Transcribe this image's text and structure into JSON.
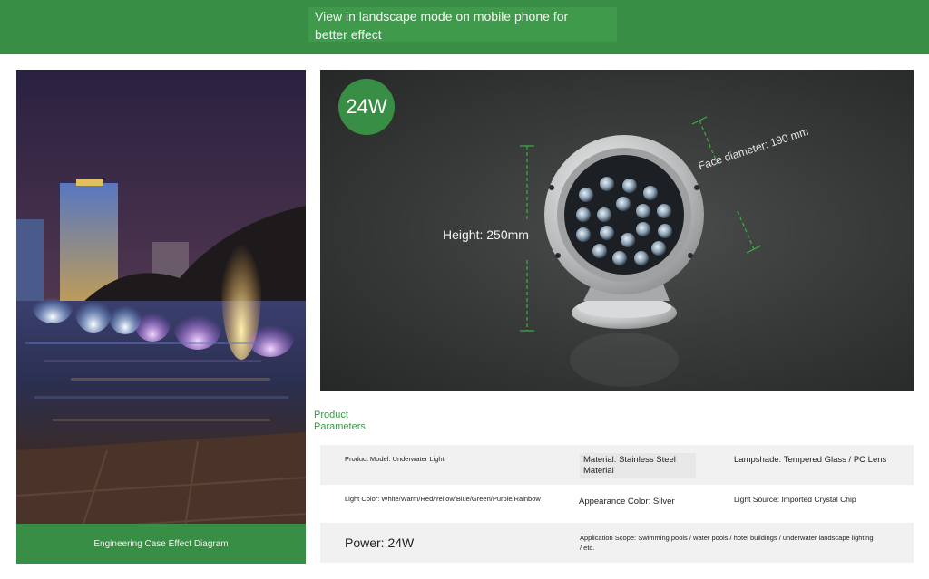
{
  "banner": {
    "notice_line1": "View in landscape mode on mobile phone for",
    "notice_line2": "better effect"
  },
  "case_image": {
    "caption": "Engineering Case Effect Diagram"
  },
  "product_image": {
    "power_badge": "24W",
    "height_label": "Height: 250mm",
    "face_label": "Face diameter: 190 mm"
  },
  "parameters": {
    "title_line1": "Product",
    "title_line2": "Parameters",
    "product_model": "Product Model: Underwater Light",
    "material_line1": "Material: Stainless Steel",
    "material_line2": "Material",
    "lampshade": "Lampshade: Tempered Glass / PC Lens",
    "light_color": "Light Color: White/Warm/Red/Yellow/Blue/Green/Purple/Rainbow",
    "appearance_color": "Appearance Color: Silver",
    "light_source": "Light Source: Imported Crystal Chip",
    "power": "Power: 24W",
    "application_line1": "Application Scope: Swimming pools / water pools / hotel buildings / underwater landscape lighting",
    "application_line2": "/ etc."
  },
  "colors": {
    "brand_green": "#388e44",
    "accent_green": "#3a9a48",
    "dimension_green": "#3fae45"
  }
}
